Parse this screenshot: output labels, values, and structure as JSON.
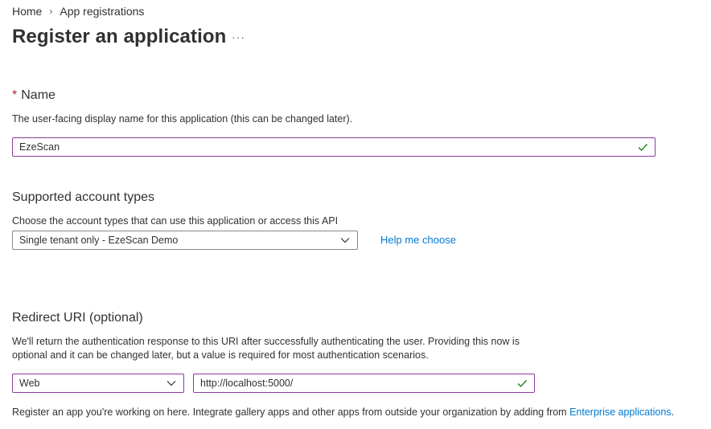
{
  "breadcrumb": {
    "home": "Home",
    "separator": "›",
    "current": "App registrations"
  },
  "page": {
    "title": "Register an application",
    "more_label": "···"
  },
  "name_section": {
    "required_mark": "*",
    "title": "Name",
    "description": "The user-facing display name for this application (this can be changed later).",
    "value": "EzeScan"
  },
  "account_types": {
    "title": "Supported account types",
    "description": "Choose the account types that can use this application or access this API",
    "selected": "Single tenant only - EzeScan Demo",
    "help_link": "Help me choose"
  },
  "redirect": {
    "title": "Redirect URI (optional)",
    "description_line1": "We'll return the authentication response to this URI after successfully authenticating the user. Providing this now is",
    "description_line2": "optional and it can be changed later, but a value is required for most authentication scenarios.",
    "platform": "Web",
    "uri": "http://localhost:5000/"
  },
  "footer": {
    "text": "Register an app you're working on here. Integrate gallery apps and other apps from outside your organization by adding from ",
    "link": "Enterprise applications",
    "suffix": "."
  },
  "colors": {
    "accent_border": "#8a3c9e",
    "link": "#0078d4",
    "check": "#107c10",
    "required": "#a4262c"
  }
}
